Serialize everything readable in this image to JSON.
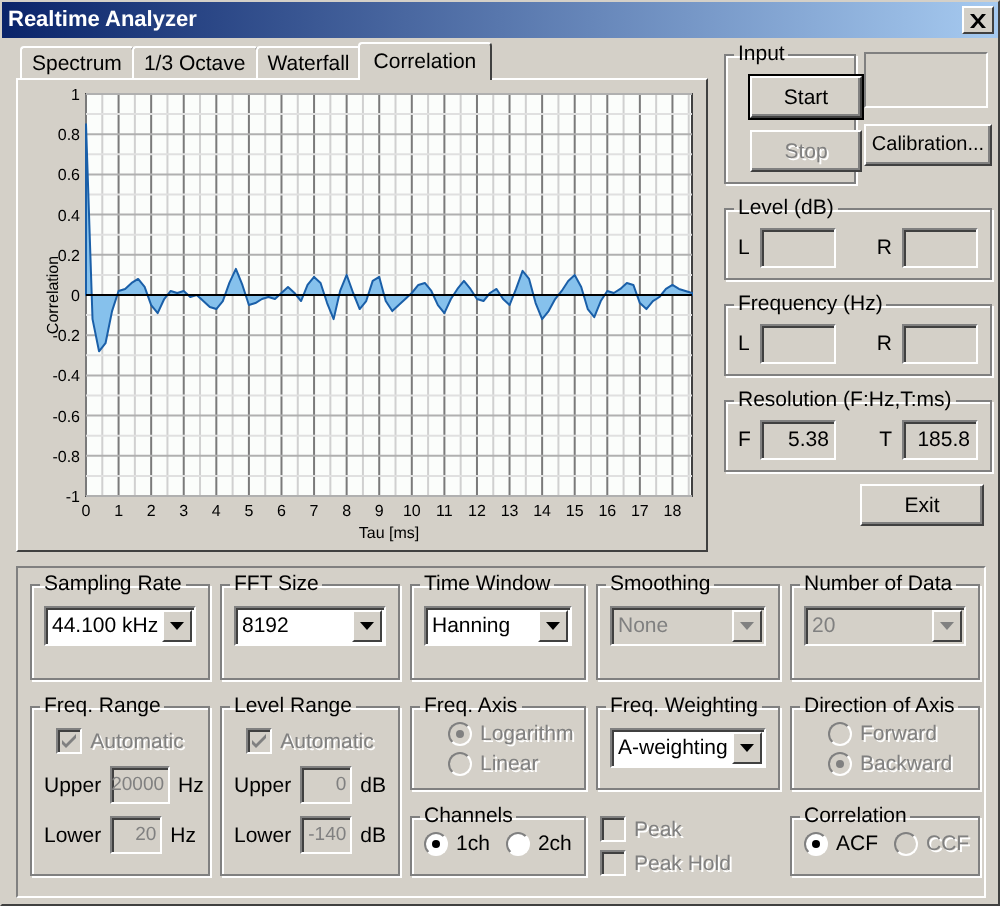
{
  "window": {
    "title": "Realtime Analyzer"
  },
  "tabs": [
    {
      "label": "Spectrum",
      "selected": false
    },
    {
      "label": "1/3 Octave",
      "selected": false
    },
    {
      "label": "Waterfall",
      "selected": false
    },
    {
      "label": "Correlation",
      "selected": true
    }
  ],
  "plot": {
    "chart_data": {
      "type": "area",
      "xlabel": "Tau [ms]",
      "ylabel": "Correlation",
      "x": [
        0,
        0.2,
        0.4,
        0.6,
        0.8,
        1,
        1.2,
        1.4,
        1.6,
        1.8,
        2,
        2.2,
        2.4,
        2.6,
        2.8,
        3,
        3.2,
        3.4,
        3.6,
        3.8,
        4,
        4.2,
        4.4,
        4.6,
        4.8,
        5,
        5.2,
        5.4,
        5.6,
        5.8,
        6,
        6.2,
        6.4,
        6.6,
        6.8,
        7,
        7.2,
        7.4,
        7.6,
        7.8,
        8,
        8.2,
        8.4,
        8.6,
        8.8,
        9,
        9.2,
        9.4,
        9.6,
        9.8,
        10,
        10.2,
        10.4,
        10.6,
        10.8,
        11,
        11.2,
        11.4,
        11.6,
        11.8,
        12,
        12.2,
        12.4,
        12.6,
        12.8,
        13,
        13.2,
        13.4,
        13.6,
        13.8,
        14,
        14.2,
        14.4,
        14.6,
        14.8,
        15,
        15.2,
        15.4,
        15.6,
        15.8,
        16,
        16.2,
        16.4,
        16.6,
        16.8,
        17,
        17.2,
        17.4,
        17.6,
        17.8,
        18,
        18.2,
        18.4,
        18.6
      ],
      "series": [
        {
          "color": "#1a5fa8",
          "values": [
            0.85,
            -0.12,
            -0.28,
            -0.24,
            -0.08,
            0.02,
            0.03,
            0.06,
            0.08,
            0.04,
            -0.05,
            -0.09,
            -0.02,
            0.02,
            0.01,
            0.02,
            -0.01,
            0,
            -0.03,
            -0.06,
            -0.07,
            -0.03,
            0.06,
            0.13,
            0.05,
            -0.05,
            -0.04,
            -0.02,
            -0.01,
            -0.02,
            0.01,
            0.04,
            0.01,
            -0.03,
            0.05,
            0.09,
            0.06,
            -0.04,
            -0.12,
            0.02,
            0.1,
            0.01,
            -0.07,
            -0.03,
            0.07,
            0.09,
            -0.03,
            -0.08,
            -0.05,
            -0.02,
            0.01,
            0.05,
            0.06,
            0.02,
            -0.05,
            -0.09,
            -0.02,
            0.03,
            0.07,
            0.03,
            -0.02,
            -0.03,
            0.01,
            0.03,
            -0.02,
            -0.05,
            0.03,
            0.12,
            0.08,
            -0.04,
            -0.12,
            -0.08,
            -0.02,
            0.02,
            0.07,
            0.1,
            0.04,
            -0.07,
            -0.11,
            -0.03,
            0.02,
            0.01,
            0.03,
            0.06,
            0.05,
            -0.04,
            -0.07,
            -0.03,
            -0.01,
            0.03,
            0.05,
            0.03,
            0.02,
            0.01
          ]
        }
      ],
      "xlim": [
        0,
        18.6
      ],
      "ylim": [
        -1,
        1
      ],
      "grid": true,
      "xticks": [
        0,
        1,
        2,
        3,
        4,
        5,
        6,
        7,
        8,
        9,
        10,
        11,
        12,
        13,
        14,
        15,
        16,
        17,
        18
      ],
      "yticks": [
        1,
        0.8,
        0.6,
        0.4,
        0.2,
        0,
        -0.2,
        -0.4,
        -0.6,
        -0.8,
        -1
      ]
    }
  },
  "input": {
    "title": "Input",
    "buttons": [
      {
        "label": "Start",
        "default": true,
        "disabled": false
      },
      {
        "label": "Stop",
        "default": false,
        "disabled": true
      }
    ]
  },
  "calibration_button": {
    "label": "Calibration..."
  },
  "level": {
    "title": "Level (dB)",
    "fields": [
      {
        "label": "L"
      },
      {
        "label": "R"
      }
    ]
  },
  "frequency": {
    "title": "Frequency (Hz)",
    "fields": [
      {
        "label": "L"
      },
      {
        "label": "R"
      }
    ]
  },
  "resolution": {
    "title": "Resolution (F:Hz,T:ms)",
    "fields": [
      {
        "label": "F",
        "value": "5.38"
      },
      {
        "label": "T",
        "value": "185.8"
      }
    ]
  },
  "exit_button": {
    "label": "Exit"
  },
  "sampling_rate": {
    "title": "Sampling Rate",
    "value": "44.100 kHz",
    "disabled": false
  },
  "fft_size": {
    "title": "FFT Size",
    "value": "8192",
    "disabled": false
  },
  "time_window": {
    "title": "Time Window",
    "value": "Hanning",
    "disabled": false
  },
  "smoothing": {
    "title": "Smoothing",
    "value": "None",
    "disabled": true
  },
  "number_of_data": {
    "title": "Number of Data",
    "value": "20",
    "disabled": true
  },
  "freq_range": {
    "title": "Freq. Range",
    "automatic": {
      "label": "Automatic",
      "checked": true,
      "disabled": true
    },
    "fields": [
      {
        "label": "Upper",
        "value": "20000",
        "unit": "Hz",
        "disabled": true
      },
      {
        "label": "Lower",
        "value": "20",
        "unit": "Hz",
        "disabled": true
      }
    ]
  },
  "level_range": {
    "title": "Level Range",
    "automatic": {
      "label": "Automatic",
      "checked": true,
      "disabled": true
    },
    "fields": [
      {
        "label": "Upper",
        "value": "0",
        "unit": "dB",
        "disabled": true
      },
      {
        "label": "Lower",
        "value": "-140",
        "unit": "dB",
        "disabled": true
      }
    ]
  },
  "freq_axis": {
    "title": "Freq. Axis",
    "options": [
      {
        "label": "Logarithm",
        "selected": true,
        "disabled": true
      },
      {
        "label": "Linear",
        "selected": false,
        "disabled": true
      }
    ]
  },
  "freq_weighting": {
    "title": "Freq. Weighting",
    "value": "A-weighting",
    "disabled": false
  },
  "direction_of_axis": {
    "title": "Direction of Axis",
    "options": [
      {
        "label": "Forward",
        "selected": false,
        "disabled": true
      },
      {
        "label": "Backward",
        "selected": true,
        "disabled": true
      }
    ]
  },
  "channels": {
    "title": "Channels",
    "options": [
      {
        "label": "1ch",
        "selected": true,
        "disabled": false
      },
      {
        "label": "2ch",
        "selected": false,
        "disabled": false
      }
    ]
  },
  "peak_options": [
    {
      "label": "Peak",
      "checked": false,
      "disabled": true
    },
    {
      "label": "Peak Hold",
      "checked": false,
      "disabled": true
    }
  ],
  "correlation": {
    "title": "Correlation",
    "options": [
      {
        "label": "ACF",
        "selected": true,
        "disabled": false
      },
      {
        "label": "CCF",
        "selected": false,
        "disabled": true
      }
    ]
  }
}
